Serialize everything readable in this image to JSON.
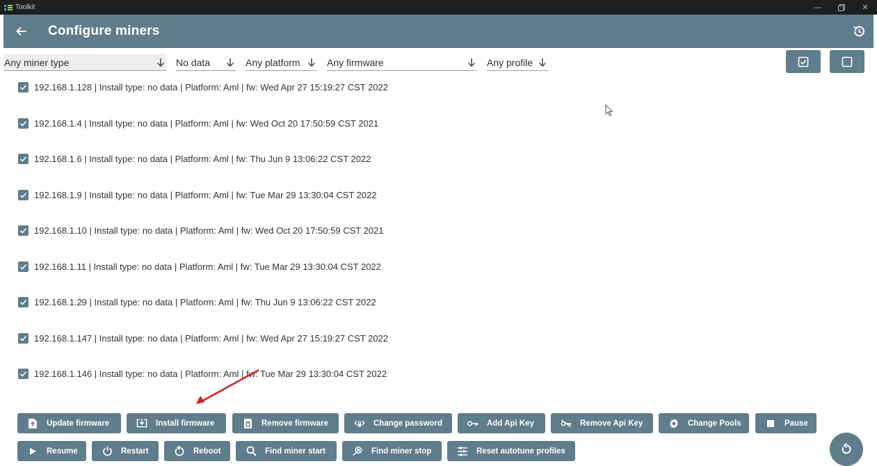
{
  "window": {
    "title": "Toolkit"
  },
  "header": {
    "title": "Configure miners"
  },
  "filters": {
    "miner_type": "Any miner type",
    "data": "No data",
    "platform": "Any platform",
    "firmware": "Any firmware",
    "profile": "Any profile"
  },
  "miners": [
    {
      "label": "192.168.1.128 | Install type: no data | Platform: Aml | fw: Wed Apr 27 15:19:27 CST 2022"
    },
    {
      "label": "192.168.1.4 | Install type: no data | Platform: Aml | fw: Wed Oct 20 17:50:59 CST 2021"
    },
    {
      "label": "192.168.1.6 | Install type: no data | Platform: Aml | fw: Thu Jun  9 13:06:22 CST 2022"
    },
    {
      "label": "192.168.1.9 | Install type: no data | Platform: Aml | fw: Tue Mar 29 13:30:04 CST 2022"
    },
    {
      "label": "192.168.1.10 | Install type: no data | Platform: Aml | fw: Wed Oct 20 17:50:59 CST 2021"
    },
    {
      "label": "192.168.1.11 | Install type: no data | Platform: Aml | fw: Tue Mar 29 13:30:04 CST 2022"
    },
    {
      "label": "192.168.1.29 | Install type: no data | Platform: Aml | fw: Thu Jun  9 13:06:22 CST 2022"
    },
    {
      "label": "192.168.1.147 | Install type: no data | Platform: Aml | fw: Wed Apr 27 15:19:27 CST 2022"
    },
    {
      "label": "192.168.1.146 | Install type: no data | Platform: Aml | fw: Tue Mar 29 13:30:04 CST 2022"
    }
  ],
  "actions": {
    "update_firmware": "Update firmware",
    "install_firmware": "Install firmware",
    "remove_firmware": "Remove firmware",
    "change_password": "Change password",
    "add_api_key": "Add Api Key",
    "remove_api_key": "Remove Api Key",
    "change_pools": "Change Pools",
    "pause": "Pause",
    "resume": "Resume",
    "restart": "Restart",
    "reboot": "Reboot",
    "find_miner_start": "Find miner start",
    "find_miner_stop": "Find miner stop",
    "reset_autotune_profiles": "Reset autotune profiles"
  },
  "colors": {
    "accent": "#5f7d8a",
    "annotation": "#d62020"
  },
  "icons": {
    "back": "arrow-left-icon",
    "history": "history-icon",
    "select_all": "checked-box-icon",
    "select_none": "empty-box-icon",
    "refresh": "refresh-icon"
  }
}
